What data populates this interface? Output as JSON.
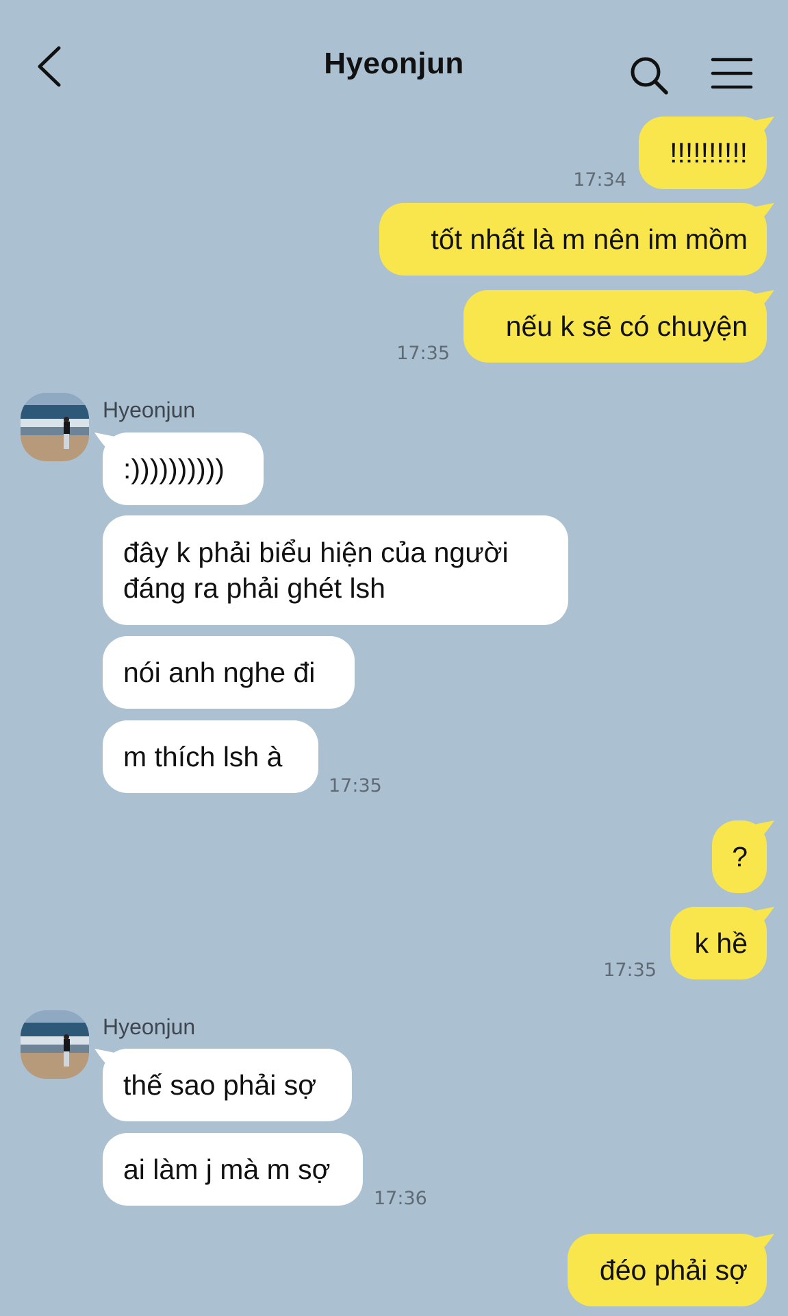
{
  "header": {
    "title": "Hyeonjun",
    "back_icon": "chevron-left-icon",
    "search_icon": "search-icon",
    "menu_icon": "hamburger-menu-icon"
  },
  "colors": {
    "background": "#abc0d1",
    "outgoing_bubble": "#f9e54c",
    "incoming_bubble": "#ffffff",
    "timestamp": "#5f6a74"
  },
  "messages": {
    "m1": "!!!!!!!!!!",
    "t1": "17:34",
    "m2": "tốt nhất là m nên im mồm",
    "m3": "nếu k sẽ có chuyện",
    "t3": "17:35",
    "sender1": "Hyeonjun",
    "m4": ":))))))))))",
    "m5": "đây k phải biểu hiện của người đáng ra phải ghét lsh",
    "m6": "nói anh nghe đi",
    "m7": "m thích lsh à",
    "t7": "17:35",
    "m8": "?",
    "m9": "k hề",
    "t9": "17:35",
    "sender2": "Hyeonjun",
    "m10": "thế sao phải sợ",
    "m11": "ai làm j mà m sợ",
    "t11": "17:36",
    "m12": "đéo phải sợ"
  }
}
